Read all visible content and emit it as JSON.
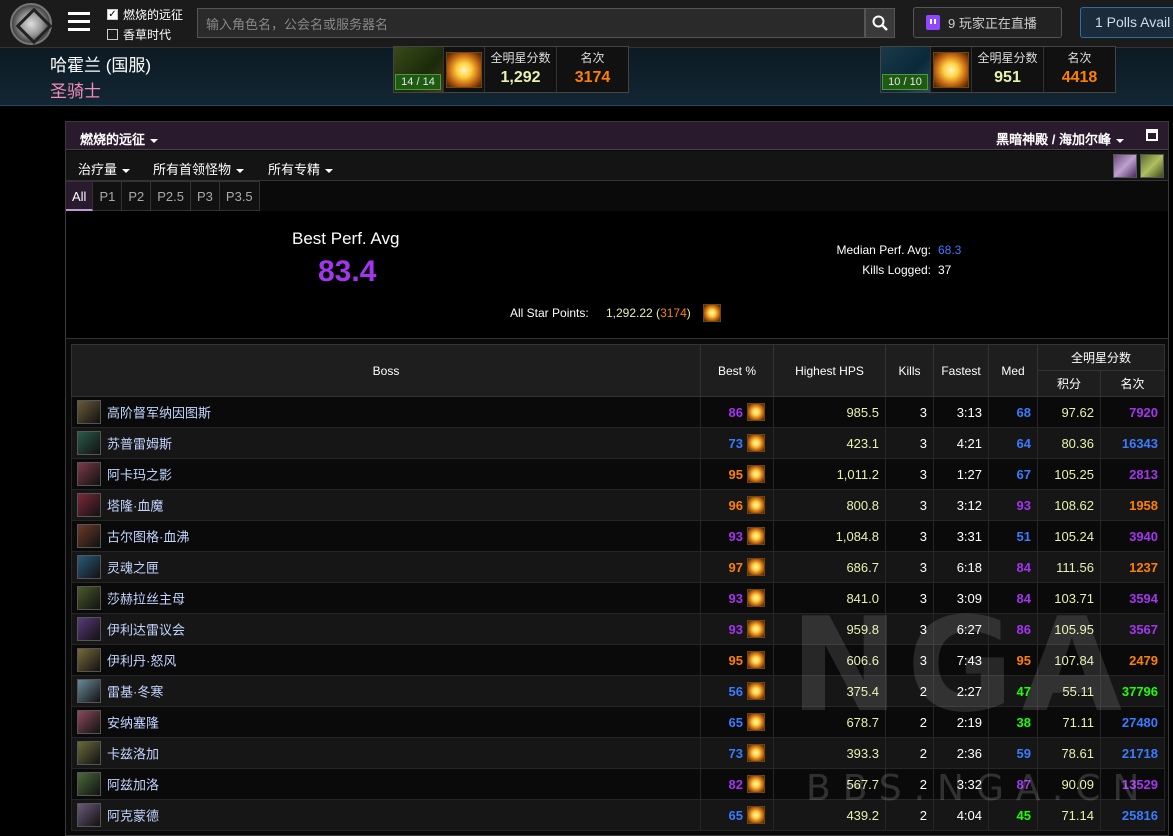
{
  "topbar": {
    "checkbox1": {
      "label": "燃烧的远征",
      "checked": true
    },
    "checkbox2": {
      "label": "香草时代",
      "checked": false
    },
    "search_placeholder": "输入角色名，公会名或服务器名",
    "twitch_label": "9 玩家正在直播",
    "polls_label": "1 Polls Avail"
  },
  "character": {
    "name": "哈霍兰 (国服)",
    "class": "圣骑士",
    "class_color": "#f58cba",
    "left_stats": {
      "progress": "14 / 14",
      "points_label": "全明星分数",
      "points": "1,292",
      "rank_label": "名次",
      "rank": "3174"
    },
    "right_stats": {
      "progress": "10 / 10",
      "points_label": "全明星分数",
      "points": "951",
      "rank_label": "名次",
      "rank": "4418"
    }
  },
  "panel": {
    "title": "燃烧的远征",
    "zone": "黑暗神殿 / 海加尔峰",
    "filters": [
      "治疗量",
      "所有首领怪物",
      "所有专精"
    ],
    "phases": [
      "All",
      "P1",
      "P2",
      "P2.5",
      "P3",
      "P3.5"
    ],
    "active_phase": "All"
  },
  "summary": {
    "best_perf_label": "Best Perf. Avg",
    "best_perf_value": "83.4",
    "median_label": "Median Perf. Avg:",
    "median_value": "68.3",
    "kills_label": "Kills Logged:",
    "kills_value": "37",
    "allstar_label": "All Star Points:",
    "allstar_value": "1,292.22",
    "allstar_rank": "3174"
  },
  "table": {
    "headers": {
      "boss": "Boss",
      "best": "Best %",
      "hps": "Highest HPS",
      "kills": "Kills",
      "fastest": "Fastest",
      "med": "Med",
      "allstar": "全明星分数",
      "points": "积分",
      "rank": "名次"
    },
    "rows": [
      {
        "boss": "高阶督军纳因图斯",
        "best": "86",
        "hps": "985.5",
        "kills": "3",
        "fastest": "3:13",
        "med": "68",
        "points": "97.62",
        "rank": "7920"
      },
      {
        "boss": "苏普雷姆斯",
        "best": "73",
        "hps": "423.1",
        "kills": "3",
        "fastest": "4:21",
        "med": "64",
        "points": "80.36",
        "rank": "16343"
      },
      {
        "boss": "阿卡玛之影",
        "best": "95",
        "hps": "1,011.2",
        "kills": "3",
        "fastest": "1:27",
        "med": "67",
        "points": "105.25",
        "rank": "2813"
      },
      {
        "boss": "塔隆·血魔",
        "best": "96",
        "hps": "800.8",
        "kills": "3",
        "fastest": "3:12",
        "med": "93",
        "points": "108.62",
        "rank": "1958"
      },
      {
        "boss": "古尔图格·血沸",
        "best": "93",
        "hps": "1,084.8",
        "kills": "3",
        "fastest": "3:31",
        "med": "51",
        "points": "105.24",
        "rank": "3940"
      },
      {
        "boss": "灵魂之匣",
        "best": "97",
        "hps": "686.7",
        "kills": "3",
        "fastest": "6:18",
        "med": "84",
        "points": "111.56",
        "rank": "1237"
      },
      {
        "boss": "莎赫拉丝主母",
        "best": "93",
        "hps": "841.0",
        "kills": "3",
        "fastest": "3:09",
        "med": "84",
        "points": "103.71",
        "rank": "3594"
      },
      {
        "boss": "伊利达雷议会",
        "best": "93",
        "hps": "959.8",
        "kills": "3",
        "fastest": "6:27",
        "med": "86",
        "points": "105.95",
        "rank": "3567"
      },
      {
        "boss": "伊利丹·怒风",
        "best": "95",
        "hps": "606.6",
        "kills": "3",
        "fastest": "7:43",
        "med": "95",
        "points": "107.84",
        "rank": "2479"
      },
      {
        "boss": "雷基·冬寒",
        "best": "56",
        "hps": "375.4",
        "kills": "2",
        "fastest": "2:27",
        "med": "47",
        "points": "55.11",
        "rank": "37796"
      },
      {
        "boss": "安纳塞隆",
        "best": "65",
        "hps": "678.7",
        "kills": "2",
        "fastest": "2:19",
        "med": "38",
        "points": "71.11",
        "rank": "27480"
      },
      {
        "boss": "卡兹洛加",
        "best": "73",
        "hps": "393.3",
        "kills": "2",
        "fastest": "2:36",
        "med": "59",
        "points": "78.61",
        "rank": "21718"
      },
      {
        "boss": "阿兹加洛",
        "best": "82",
        "hps": "567.7",
        "kills": "2",
        "fastest": "3:32",
        "med": "87",
        "points": "90.09",
        "rank": "13529"
      },
      {
        "boss": "阿克蒙德",
        "best": "65",
        "hps": "439.2",
        "kills": "2",
        "fastest": "4:04",
        "med": "45",
        "points": "71.14",
        "rank": "25816"
      }
    ]
  },
  "watermark": {
    "logo": "NGA",
    "url": "BBS.NGA.CN"
  },
  "colors": {
    "epic": "#a335ee",
    "rare": "#3a7bff",
    "legendary": "#ff8000",
    "uncommon": "#1eff00",
    "accent": "#2a1a2e"
  }
}
